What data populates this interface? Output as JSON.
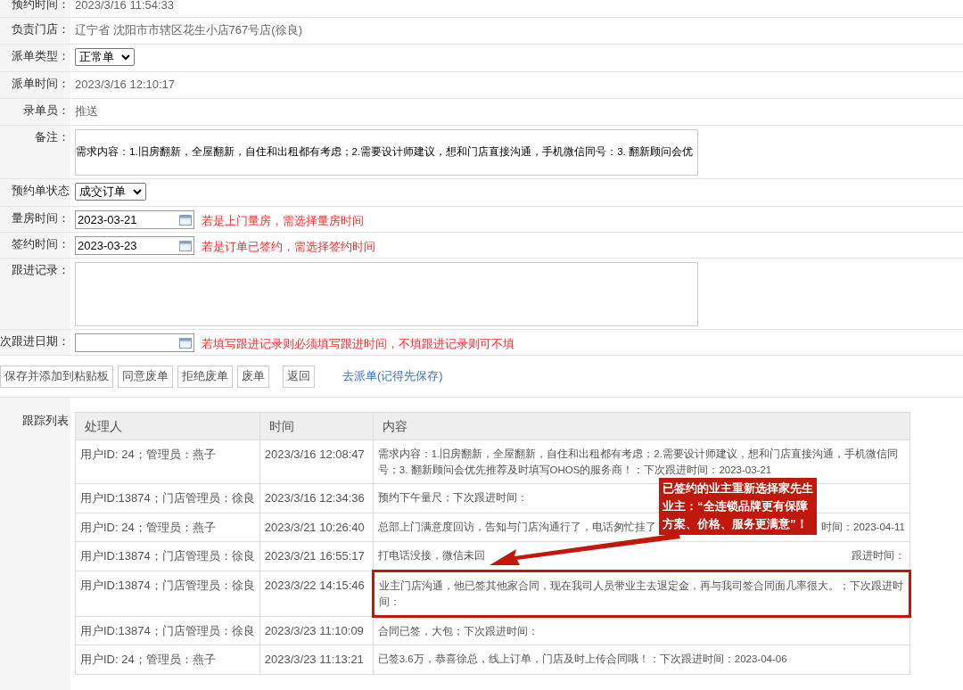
{
  "form": {
    "rows": [
      {
        "kind": "text",
        "label": "预约时间：",
        "value": "2023/3/16 11:54:33"
      },
      {
        "kind": "text",
        "label": "负责门店：",
        "value": "辽宁省 沈阳市市辖区花生小店767号店(徐良)"
      },
      {
        "kind": "select",
        "label": "派单类型：",
        "value": "正常单"
      },
      {
        "kind": "text",
        "label": "派单时间：",
        "value": "2023/3/16 12:10:17"
      },
      {
        "kind": "text",
        "label": "录单员：",
        "value": "推送"
      },
      {
        "kind": "note",
        "label": "备注：",
        "value": "需求内容：1.旧房翻新，全屋翻新，自住和出租都有考虑；2.需要设计师建议，想和门店直接沟通，手机微信同号：3. 翻新顾问会优"
      },
      {
        "kind": "select",
        "label": "预约单状态",
        "value": "成交订单"
      },
      {
        "kind": "date",
        "label": "量房时间：",
        "value": "2023-03-21",
        "hint": "若是上门量房，需选择量房时间"
      },
      {
        "kind": "date",
        "label": "签约时间：",
        "value": "2023-03-23",
        "hint": "若是订单已签约，需选择签约时间"
      },
      {
        "kind": "textarea",
        "label": "跟进记录："
      },
      {
        "kind": "date",
        "label": "次跟进日期：",
        "hint": "若填写跟进记录则必须填写跟进时间，不填跟进记录则可不填"
      }
    ]
  },
  "buttons": [
    "保存并添加到粘贴板",
    "同意废单",
    "拒绝废单",
    "废单",
    "返回"
  ],
  "link": "去派单(记得先保存)",
  "tracking": {
    "label": "跟踪列表",
    "columns": [
      "处理人",
      "时间",
      "内容"
    ],
    "rows": [
      {
        "handler": "用户ID: 24；管理员：燕子",
        "time": "2023/3/16 12:08:47",
        "content": [
          "需求内容：1.旧房翻新，全屋翻新，自住和出租都有考虑；2.需要设计师建议，想和门店直接沟通，手机微信同号；3. 翻新顾问会优先推荐及时填写OHOS的服务商！：下次跟进时间：2023-03-21"
        ],
        "highlighted": false
      },
      {
        "handler": "用户ID:13874；门店管理员：徐良",
        "time": "2023/3/16 12:34:36",
        "content": [
          "预约下午量尺；下次跟进时间："
        ],
        "highlighted": false
      },
      {
        "handler": "用户ID: 24；管理员：燕子",
        "time": "2023/3/21 10:26:40",
        "content": [
          "总部上门满意度回访，告知与门店沟通行了，电话匆忙挂了",
          "时间：2023-04-11"
        ],
        "highlighted": false
      },
      {
        "handler": "用户ID:13874；门店管理员：徐良",
        "time": "2023/3/21 16:55:17",
        "content": [
          "打电话没接，微信未回",
          "跟进时间："
        ],
        "highlighted": false
      },
      {
        "handler": "用户ID:13874；门店管理员：徐良",
        "time": "2023/3/22 14:15:46",
        "content": [
          "业主门店沟通，他已签其他家合同，现在我司人员带业主去退定金，再与我司签合同面几率很大。；下次跟进时间："
        ],
        "highlighted": true
      },
      {
        "handler": "用户ID:13874；门店管理员：徐良",
        "time": "2023/3/23 11:10:09",
        "content": [
          "合同已签，大包；下次跟进时间："
        ],
        "highlighted": false
      },
      {
        "handler": "用户ID: 24；管理员：燕子",
        "time": "2023/3/23 11:13:21",
        "content": [
          "已签3.6万，恭喜徐总，线上订单，门店及时上传合同哦！：下次跟进时间：2023-04-06"
        ],
        "highlighted": false
      }
    ]
  },
  "callout": {
    "lines": [
      "已签约的业主重新选择家先生",
      "业主：“全连锁品牌更有保障",
      "方案、价格、服务更满意”！"
    ]
  }
}
